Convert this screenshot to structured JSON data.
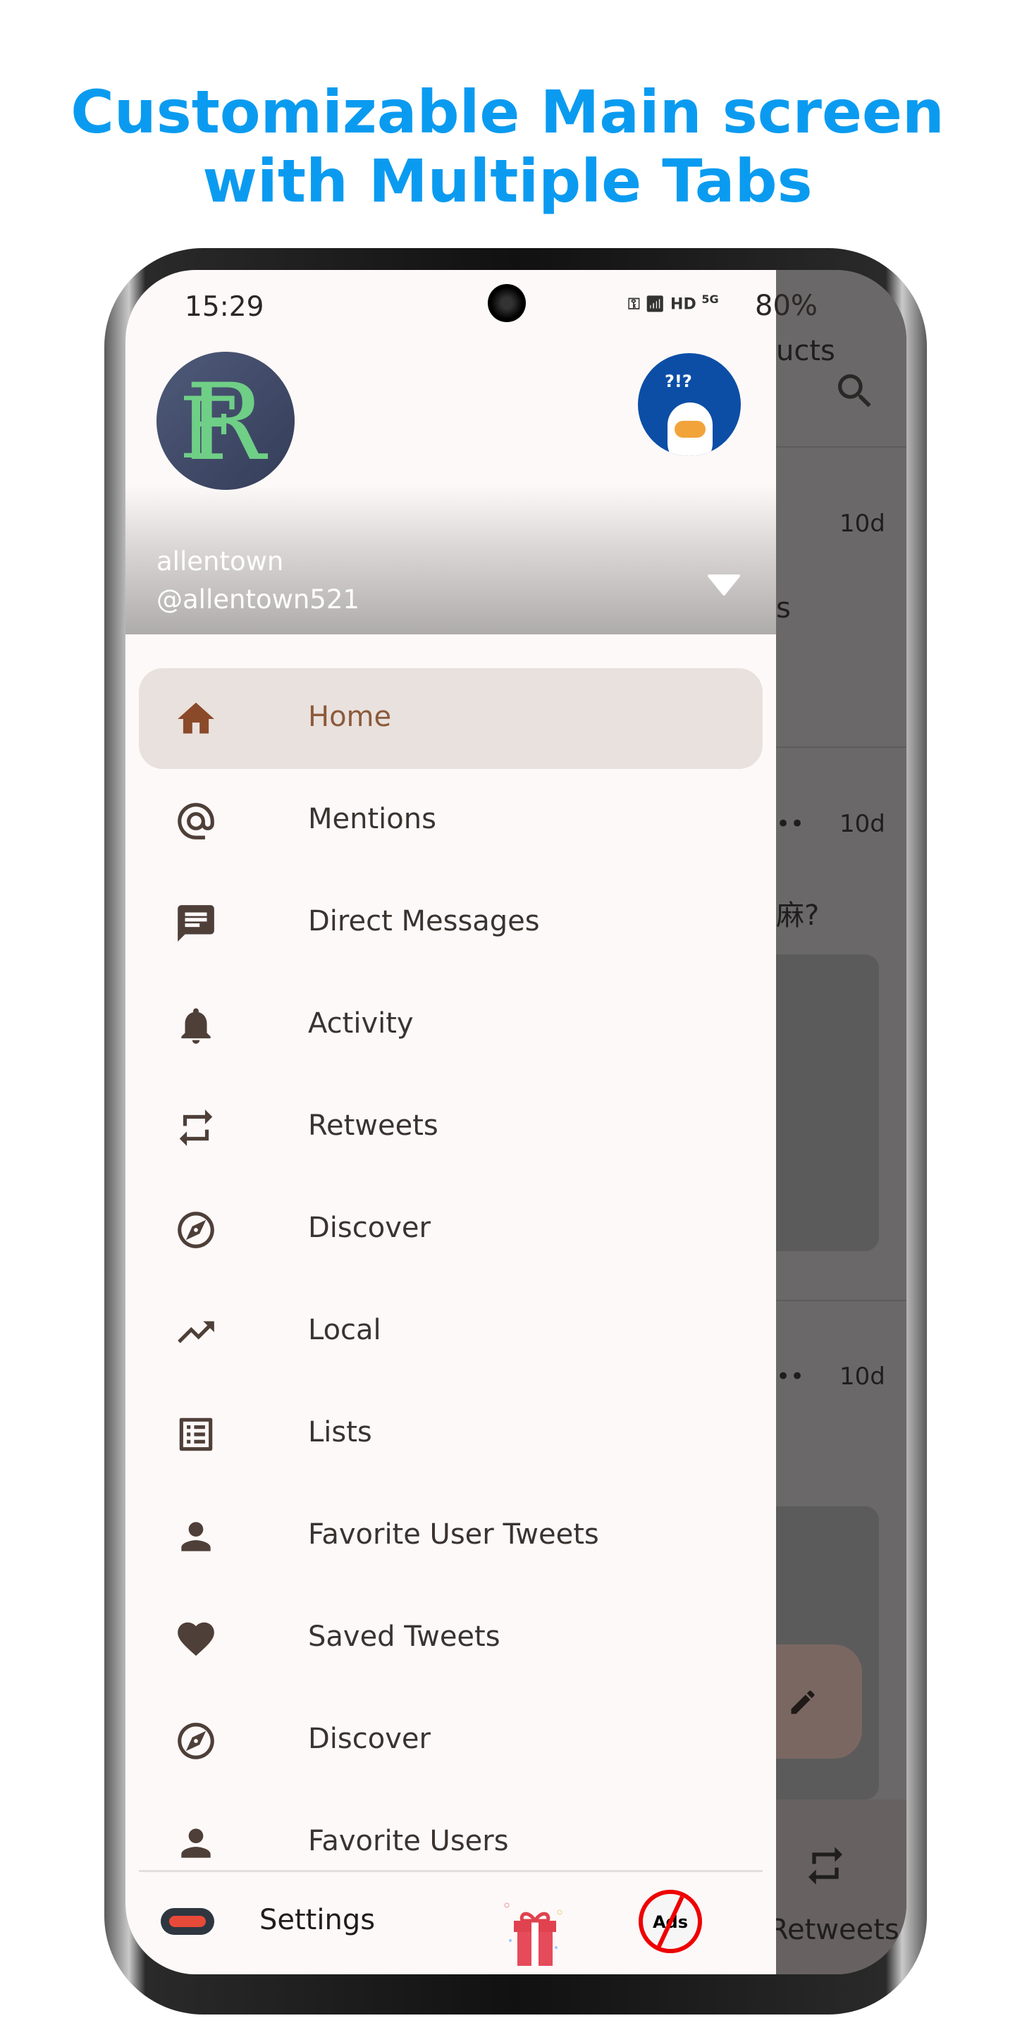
{
  "headline": {
    "line1": "Customizable Main screen",
    "line2": "with Multiple Tabs",
    "color": "#0a9bf0"
  },
  "status_bar": {
    "time": "15:29",
    "network": "HD",
    "signal": "5G",
    "battery": "80%"
  },
  "drawer": {
    "account": {
      "name": "allentown",
      "handle": "@allentown521",
      "avatar_letter": "FR"
    },
    "menu": [
      {
        "label": "Home",
        "icon": "home-icon",
        "active": true
      },
      {
        "label": "Mentions",
        "icon": "at-icon"
      },
      {
        "label": "Direct Messages",
        "icon": "message-icon"
      },
      {
        "label": "Activity",
        "icon": "bell-icon"
      },
      {
        "label": "Retweets",
        "icon": "retweet-icon"
      },
      {
        "label": "Discover",
        "icon": "compass-icon"
      },
      {
        "label": "Local",
        "icon": "trending-icon"
      },
      {
        "label": "Lists",
        "icon": "list-icon"
      },
      {
        "label": "Favorite User Tweets",
        "icon": "person-icon"
      },
      {
        "label": "Saved Tweets",
        "icon": "heart-icon"
      },
      {
        "label": "Discover",
        "icon": "compass-icon"
      },
      {
        "label": "Favorite Users",
        "icon": "person-icon"
      }
    ],
    "footer": {
      "settings_label": "Settings",
      "no_ads_text": "Ads"
    }
  },
  "background": {
    "title_fragment": "ucts",
    "tweets": [
      {
        "time": "10d",
        "text_fragment": "s"
      },
      {
        "time": "10d",
        "text_fragment": "麻?"
      },
      {
        "time": "10d"
      }
    ],
    "bottom_tab": "Retweets"
  },
  "colors": {
    "accent": "#8c5a3c",
    "drawer_bg": "#fdf9f8",
    "active_bg": "#e9e1dd",
    "scrim": "#6a6868"
  }
}
